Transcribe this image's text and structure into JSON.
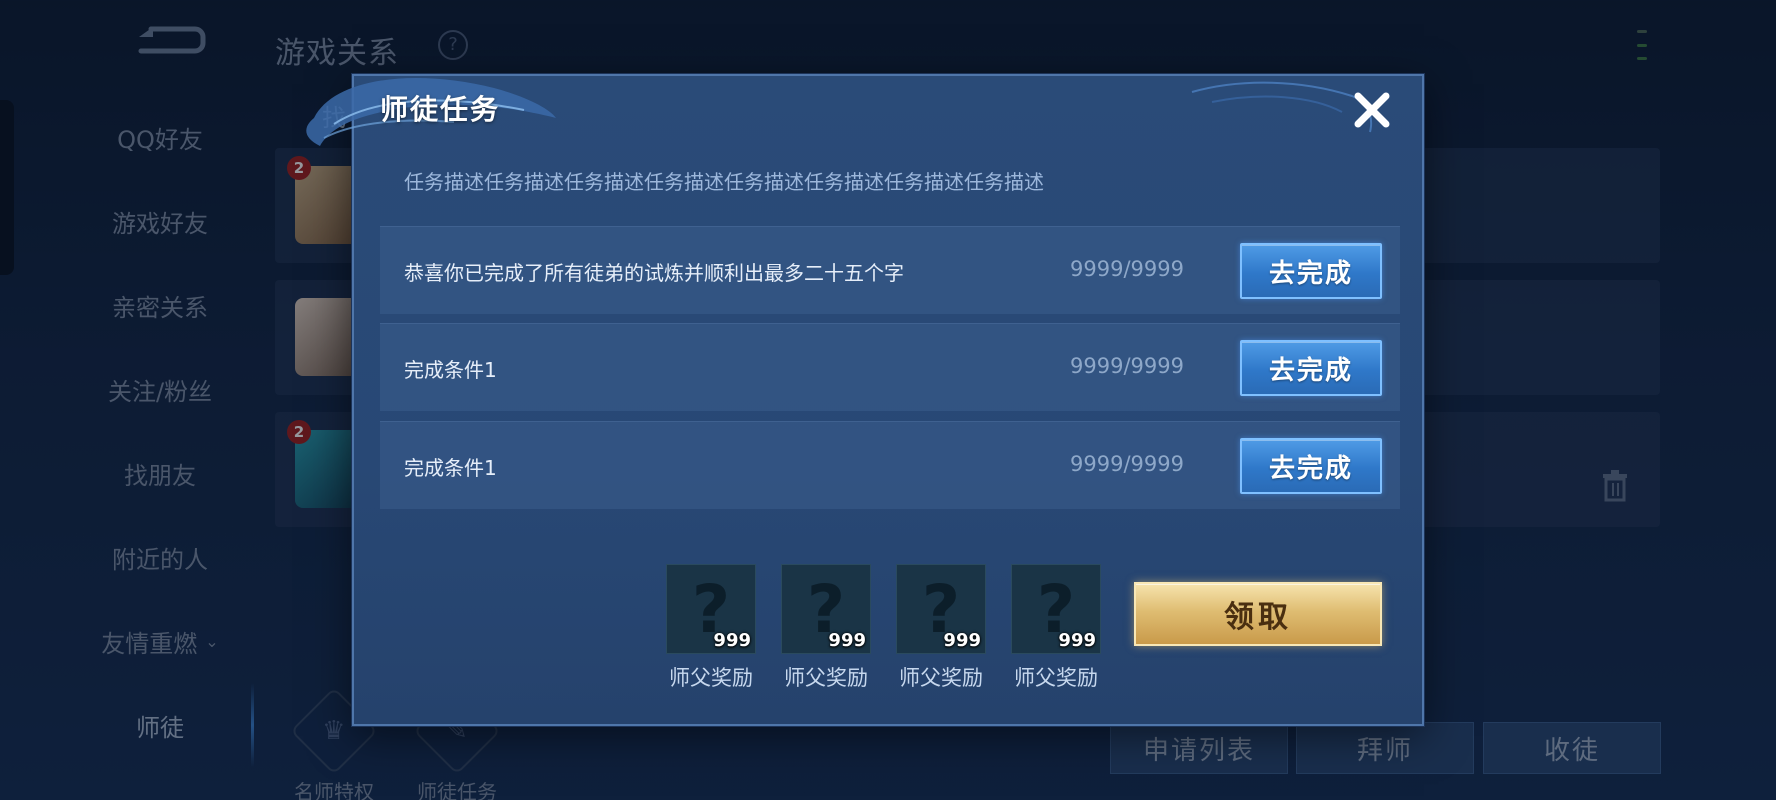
{
  "background": {
    "page_title": "游戏关系",
    "help_icon": "?",
    "sidebar": [
      {
        "label": "QQ好友"
      },
      {
        "label": "游戏好友"
      },
      {
        "label": "亲密关系"
      },
      {
        "label": "关注/粉丝"
      },
      {
        "label": "找朋友"
      },
      {
        "label": "附近的人"
      },
      {
        "label": "友情重燃",
        "chevron": "⌄"
      },
      {
        "label": "师徒"
      }
    ],
    "friend_tab_partial": "找",
    "rows": [
      {
        "badge": "2"
      },
      {
        "badge": ""
      },
      {
        "badge": "2"
      }
    ],
    "bottom_tabs": [
      {
        "label": "名师特权",
        "glyph": "♛"
      },
      {
        "label": "师徒任务",
        "glyph": "✎"
      }
    ],
    "bottom_buttons": [
      "申请列表",
      "拜师",
      "收徒"
    ]
  },
  "modal": {
    "title": "师徒任务",
    "description": "任务描述任务描述任务描述任务描述任务描述任务描述任务描述任务描述",
    "tasks": [
      {
        "text": "恭喜你已完成了所有徒弟的试炼并顺利出最多二十五个字",
        "progress": "9999/9999",
        "button": "去完成"
      },
      {
        "text": "完成条件1",
        "progress": "9999/9999",
        "button": "去完成"
      },
      {
        "text": "完成条件1",
        "progress": "9999/9999",
        "button": "去完成"
      }
    ],
    "rewards": [
      {
        "symbol": "?",
        "count": "999",
        "label": "师父奖励"
      },
      {
        "symbol": "?",
        "count": "999",
        "label": "师父奖励"
      },
      {
        "symbol": "?",
        "count": "999",
        "label": "师父奖励"
      },
      {
        "symbol": "?",
        "count": "999",
        "label": "师父奖励"
      }
    ],
    "claim_button": "领取"
  },
  "colors": {
    "primary_button": "#2f78c9",
    "claim_button": "#dfbd72",
    "modal_bg": "#2a4b78"
  }
}
